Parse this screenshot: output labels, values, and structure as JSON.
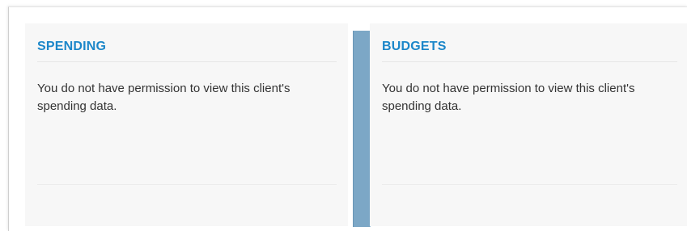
{
  "spending": {
    "title": "SPENDING",
    "message": "You do not have permission to view this client's spending data."
  },
  "budgets": {
    "title": "BUDGETS",
    "message": "You do not have permission to view this client's spending data."
  },
  "colors": {
    "title_blue": "#1c87c9",
    "divider_blue": "#7ca7c6",
    "panel_bg": "#f7f7f7",
    "text": "#333333"
  }
}
